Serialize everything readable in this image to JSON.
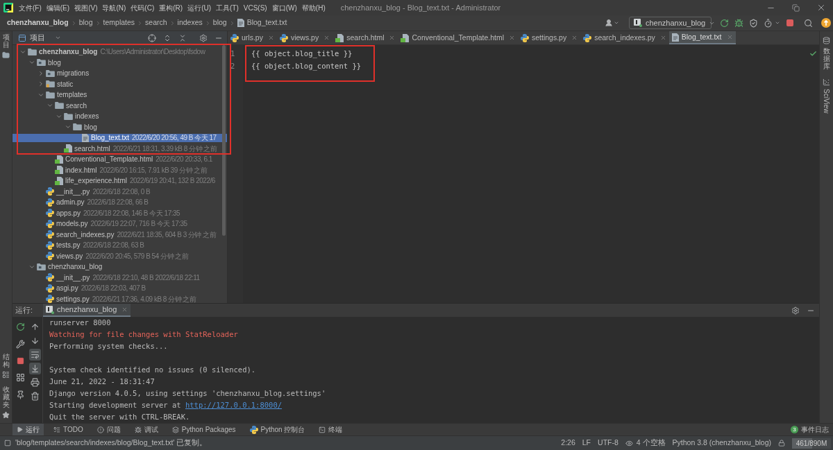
{
  "window": {
    "title": "chenzhanxu_blog - Blog_text.txt - Administrator"
  },
  "menu": [
    "文件(F)",
    "编辑(E)",
    "视图(V)",
    "导航(N)",
    "代码(C)",
    "重构(R)",
    "运行(U)",
    "工具(T)",
    "VCS(S)",
    "窗口(W)",
    "帮助(H)"
  ],
  "breadcrumb": [
    {
      "label": "chenzhanxu_blog",
      "kind": "project"
    },
    {
      "label": "blog",
      "kind": "folder"
    },
    {
      "label": "templates",
      "kind": "folder"
    },
    {
      "label": "search",
      "kind": "folder"
    },
    {
      "label": "indexes",
      "kind": "folder"
    },
    {
      "label": "blog",
      "kind": "folder"
    },
    {
      "label": "Blog_text.txt",
      "kind": "txt"
    }
  ],
  "run_config": {
    "label": "chenzhanxu_blog"
  },
  "left_stripe": {
    "top": [
      {
        "label": "项目",
        "kind": "project"
      }
    ],
    "bottom": [
      {
        "label": "结构",
        "kind": "structure"
      },
      {
        "label": "收藏夹",
        "kind": "favorites"
      }
    ]
  },
  "right_stripe": [
    {
      "label": "数据库",
      "kind": "database"
    },
    {
      "label": "SciView",
      "kind": "sciview"
    }
  ],
  "project_panel": {
    "title": "项目",
    "tree": [
      {
        "name": "chenzhanxu_blog",
        "kind": "root",
        "meta": "C:\\Users\\Administrator\\Desktop\\fsdow",
        "expanded": true,
        "selected": false,
        "children": [
          {
            "name": "blog",
            "kind": "module",
            "expanded": true,
            "selected": false,
            "children": [
              {
                "name": "migrations",
                "kind": "module",
                "expanded": false,
                "selected": false
              },
              {
                "name": "static",
                "kind": "resources",
                "expanded": false,
                "selected": false
              },
              {
                "name": "templates",
                "kind": "folder",
                "expanded": true,
                "selected": false,
                "children": [
                  {
                    "name": "search",
                    "kind": "folder",
                    "expanded": true,
                    "selected": false,
                    "children": [
                      {
                        "name": "indexes",
                        "kind": "folder",
                        "expanded": true,
                        "selected": false,
                        "children": [
                          {
                            "name": "blog",
                            "kind": "folder",
                            "expanded": true,
                            "selected": false,
                            "children": [
                              {
                                "name": "Blog_text.txt",
                                "kind": "txt",
                                "meta": "2022/6/20 20:56, 49 B 今天 17",
                                "selected": true
                              }
                            ]
                          }
                        ]
                      },
                      {
                        "name": "search.html",
                        "kind": "html",
                        "meta": "2022/6/21 18:31, 3.39 kB 8 分钟 之前",
                        "selected": false
                      }
                    ]
                  },
                  {
                    "name": "Conventional_Template.html",
                    "kind": "html",
                    "meta": "2022/6/20 20:33, 6.1",
                    "selected": false
                  },
                  {
                    "name": "index.html",
                    "kind": "html",
                    "meta": "2022/6/20 16:15, 7.91 kB 39 分钟 之前",
                    "selected": false
                  },
                  {
                    "name": "life_experience.html",
                    "kind": "html",
                    "meta": "2022/6/19 20:41, 132 B 2022/6",
                    "selected": false
                  }
                ]
              },
              {
                "name": "__init__.py",
                "kind": "py",
                "meta": "2022/6/18 22:08, 0 B",
                "selected": false
              },
              {
                "name": "admin.py",
                "kind": "py",
                "meta": "2022/6/18 22:08, 66 B",
                "selected": false
              },
              {
                "name": "apps.py",
                "kind": "py",
                "meta": "2022/6/18 22:08, 146 B 今天 17:35",
                "selected": false
              },
              {
                "name": "models.py",
                "kind": "py",
                "meta": "2022/6/19 22:07, 716 B 今天 17:35",
                "selected": false
              },
              {
                "name": "search_indexes.py",
                "kind": "py",
                "meta": "2022/6/21 18:35, 604 B 3 分钟 之前",
                "selected": false
              },
              {
                "name": "tests.py",
                "kind": "py",
                "meta": "2022/6/18 22:08, 63 B",
                "selected": false
              },
              {
                "name": "views.py",
                "kind": "py",
                "meta": "2022/6/20 20:45, 579 B 54 分钟 之前",
                "selected": false
              }
            ]
          },
          {
            "name": "chenzhanxu_blog",
            "kind": "module",
            "expanded": true,
            "selected": false,
            "children": [
              {
                "name": "__init__.py",
                "kind": "py",
                "meta": "2022/6/18 22:10, 48 B 2022/6/18 22:11",
                "selected": false
              },
              {
                "name": "asgi.py",
                "kind": "py",
                "meta": "2022/6/18 22:03, 407 B",
                "selected": false
              },
              {
                "name": "settings.py",
                "kind": "py",
                "meta": "2022/6/21 17:36, 4.09 kB 8 分钟 之前",
                "selected": false
              }
            ]
          }
        ]
      }
    ]
  },
  "editor_tabs": [
    {
      "label": "urls.py",
      "kind": "py",
      "selected": false
    },
    {
      "label": "views.py",
      "kind": "py",
      "selected": false
    },
    {
      "label": "search.html",
      "kind": "html",
      "selected": false
    },
    {
      "label": "Conventional_Template.html",
      "kind": "html",
      "selected": false
    },
    {
      "label": "settings.py",
      "kind": "py",
      "selected": false
    },
    {
      "label": "search_indexes.py",
      "kind": "py",
      "selected": false
    },
    {
      "label": "Blog_text.txt",
      "kind": "txt",
      "selected": true
    }
  ],
  "editor": {
    "lines": [
      {
        "number": "1",
        "text": "{{ object.blog_title }}"
      },
      {
        "number": "2",
        "text": "{{ object.blog_content }}"
      }
    ]
  },
  "run_panel": {
    "label": "运行:",
    "tab": "chenzhanxu_blog",
    "soft_wrap": true,
    "scroll_to_end": true,
    "console": [
      {
        "kind": "plain",
        "text": "runserver 8000"
      },
      {
        "kind": "error",
        "text": "Watching for file changes with StatReloader"
      },
      {
        "kind": "plain",
        "text": "Performing system checks..."
      },
      {
        "kind": "blank"
      },
      {
        "kind": "plain",
        "text": "System check identified no issues (0 silenced)."
      },
      {
        "kind": "plain",
        "text": "June 21, 2022 - 18:31:47"
      },
      {
        "kind": "plain",
        "text": "Django version 4.0.5, using settings 'chenzhanxu_blog.settings'"
      },
      {
        "kind": "link",
        "text": "Starting development server at ",
        "link": "http://127.0.0.1:8000/"
      },
      {
        "kind": "plain",
        "text": "Quit the server with CTRL-BREAK."
      }
    ]
  },
  "tool_windows": [
    {
      "label": "运行",
      "kind": "run",
      "selected": true
    },
    {
      "label": "TODO",
      "kind": "todo",
      "selected": false
    },
    {
      "label": "问题",
      "kind": "problems",
      "selected": false
    },
    {
      "label": "调试",
      "kind": "debug",
      "selected": false
    },
    {
      "label": "Python Packages",
      "kind": "packages",
      "selected": false
    },
    {
      "label": "Python 控制台",
      "kind": "console",
      "selected": false
    },
    {
      "label": "终端",
      "kind": "terminal",
      "selected": false
    }
  ],
  "event_log": {
    "count": "3",
    "label": "事件日志"
  },
  "status_bar": {
    "message": "'blog/templates/search/indexes/blog/Blog_text.txt' 已复制。",
    "caret": "2:26",
    "line_separator": "LF",
    "encoding": "UTF-8",
    "indent": "4 个空格",
    "interpreter": "Python 3.8 (chenzhanxu_blog)",
    "memory": {
      "text": "461/890M",
      "level": 0.52
    }
  }
}
